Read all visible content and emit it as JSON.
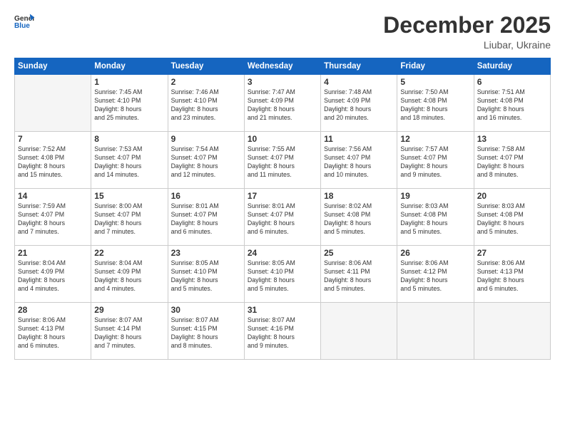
{
  "header": {
    "logo_line1": "General",
    "logo_line2": "Blue",
    "month": "December 2025",
    "location": "Liubar, Ukraine"
  },
  "days_of_week": [
    "Sunday",
    "Monday",
    "Tuesday",
    "Wednesday",
    "Thursday",
    "Friday",
    "Saturday"
  ],
  "weeks": [
    [
      {
        "day": "",
        "info": ""
      },
      {
        "day": "1",
        "info": "Sunrise: 7:45 AM\nSunset: 4:10 PM\nDaylight: 8 hours\nand 25 minutes."
      },
      {
        "day": "2",
        "info": "Sunrise: 7:46 AM\nSunset: 4:10 PM\nDaylight: 8 hours\nand 23 minutes."
      },
      {
        "day": "3",
        "info": "Sunrise: 7:47 AM\nSunset: 4:09 PM\nDaylight: 8 hours\nand 21 minutes."
      },
      {
        "day": "4",
        "info": "Sunrise: 7:48 AM\nSunset: 4:09 PM\nDaylight: 8 hours\nand 20 minutes."
      },
      {
        "day": "5",
        "info": "Sunrise: 7:50 AM\nSunset: 4:08 PM\nDaylight: 8 hours\nand 18 minutes."
      },
      {
        "day": "6",
        "info": "Sunrise: 7:51 AM\nSunset: 4:08 PM\nDaylight: 8 hours\nand 16 minutes."
      }
    ],
    [
      {
        "day": "7",
        "info": "Sunrise: 7:52 AM\nSunset: 4:08 PM\nDaylight: 8 hours\nand 15 minutes."
      },
      {
        "day": "8",
        "info": "Sunrise: 7:53 AM\nSunset: 4:07 PM\nDaylight: 8 hours\nand 14 minutes."
      },
      {
        "day": "9",
        "info": "Sunrise: 7:54 AM\nSunset: 4:07 PM\nDaylight: 8 hours\nand 12 minutes."
      },
      {
        "day": "10",
        "info": "Sunrise: 7:55 AM\nSunset: 4:07 PM\nDaylight: 8 hours\nand 11 minutes."
      },
      {
        "day": "11",
        "info": "Sunrise: 7:56 AM\nSunset: 4:07 PM\nDaylight: 8 hours\nand 10 minutes."
      },
      {
        "day": "12",
        "info": "Sunrise: 7:57 AM\nSunset: 4:07 PM\nDaylight: 8 hours\nand 9 minutes."
      },
      {
        "day": "13",
        "info": "Sunrise: 7:58 AM\nSunset: 4:07 PM\nDaylight: 8 hours\nand 8 minutes."
      }
    ],
    [
      {
        "day": "14",
        "info": "Sunrise: 7:59 AM\nSunset: 4:07 PM\nDaylight: 8 hours\nand 7 minutes."
      },
      {
        "day": "15",
        "info": "Sunrise: 8:00 AM\nSunset: 4:07 PM\nDaylight: 8 hours\nand 7 minutes."
      },
      {
        "day": "16",
        "info": "Sunrise: 8:01 AM\nSunset: 4:07 PM\nDaylight: 8 hours\nand 6 minutes."
      },
      {
        "day": "17",
        "info": "Sunrise: 8:01 AM\nSunset: 4:07 PM\nDaylight: 8 hours\nand 6 minutes."
      },
      {
        "day": "18",
        "info": "Sunrise: 8:02 AM\nSunset: 4:08 PM\nDaylight: 8 hours\nand 5 minutes."
      },
      {
        "day": "19",
        "info": "Sunrise: 8:03 AM\nSunset: 4:08 PM\nDaylight: 8 hours\nand 5 minutes."
      },
      {
        "day": "20",
        "info": "Sunrise: 8:03 AM\nSunset: 4:08 PM\nDaylight: 8 hours\nand 5 minutes."
      }
    ],
    [
      {
        "day": "21",
        "info": "Sunrise: 8:04 AM\nSunset: 4:09 PM\nDaylight: 8 hours\nand 4 minutes."
      },
      {
        "day": "22",
        "info": "Sunrise: 8:04 AM\nSunset: 4:09 PM\nDaylight: 8 hours\nand 4 minutes."
      },
      {
        "day": "23",
        "info": "Sunrise: 8:05 AM\nSunset: 4:10 PM\nDaylight: 8 hours\nand 5 minutes."
      },
      {
        "day": "24",
        "info": "Sunrise: 8:05 AM\nSunset: 4:10 PM\nDaylight: 8 hours\nand 5 minutes."
      },
      {
        "day": "25",
        "info": "Sunrise: 8:06 AM\nSunset: 4:11 PM\nDaylight: 8 hours\nand 5 minutes."
      },
      {
        "day": "26",
        "info": "Sunrise: 8:06 AM\nSunset: 4:12 PM\nDaylight: 8 hours\nand 5 minutes."
      },
      {
        "day": "27",
        "info": "Sunrise: 8:06 AM\nSunset: 4:13 PM\nDaylight: 8 hours\nand 6 minutes."
      }
    ],
    [
      {
        "day": "28",
        "info": "Sunrise: 8:06 AM\nSunset: 4:13 PM\nDaylight: 8 hours\nand 6 minutes."
      },
      {
        "day": "29",
        "info": "Sunrise: 8:07 AM\nSunset: 4:14 PM\nDaylight: 8 hours\nand 7 minutes."
      },
      {
        "day": "30",
        "info": "Sunrise: 8:07 AM\nSunset: 4:15 PM\nDaylight: 8 hours\nand 8 minutes."
      },
      {
        "day": "31",
        "info": "Sunrise: 8:07 AM\nSunset: 4:16 PM\nDaylight: 8 hours\nand 9 minutes."
      },
      {
        "day": "",
        "info": ""
      },
      {
        "day": "",
        "info": ""
      },
      {
        "day": "",
        "info": ""
      }
    ]
  ]
}
